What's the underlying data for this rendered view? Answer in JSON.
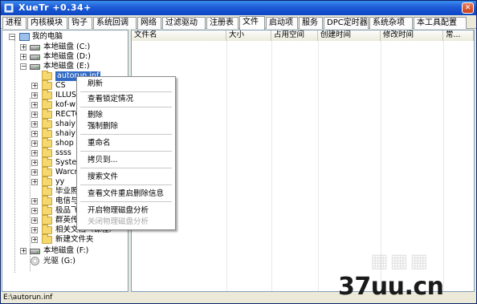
{
  "window": {
    "title": "XueTr +0.34+",
    "close_glyph": "✕"
  },
  "tabs": [
    "进程",
    "内核模块",
    "钩子",
    "系统回调",
    "网络",
    "过滤驱动",
    "注册表",
    "文件",
    "启动项",
    "服务",
    "DPC定时器",
    "系统杂项",
    "本工具配置"
  ],
  "active_tab": "文件",
  "tree": {
    "items": [
      {
        "label": "我的电脑",
        "icon": "computer-icon",
        "expander": "−"
      },
      {
        "label": "本地磁盘 (C:)",
        "icon": "drive-icon",
        "expander": "+"
      },
      {
        "label": "本地磁盘 (D:)",
        "icon": "drive-icon",
        "expander": "+"
      },
      {
        "label": "本地磁盘 (E:)",
        "icon": "drive-icon",
        "expander": "−"
      },
      {
        "label": "autorun.inf",
        "icon": "folder-icon",
        "expander": ""
      },
      {
        "label": "CS",
        "icon": "folder-icon",
        "expander": "+"
      },
      {
        "label": "ILLUS",
        "icon": "folder-icon",
        "expander": "+"
      },
      {
        "label": "kof-w",
        "icon": "folder-icon",
        "expander": "+"
      },
      {
        "label": "RECTC",
        "icon": "folder-icon",
        "expander": "+"
      },
      {
        "label": "shaiy",
        "icon": "folder-icon",
        "expander": "+"
      },
      {
        "label": "shaiy",
        "icon": "folder-icon",
        "expander": "+"
      },
      {
        "label": "shop",
        "icon": "folder-icon",
        "expander": "+"
      },
      {
        "label": "ssss",
        "icon": "folder-icon",
        "expander": "+"
      },
      {
        "label": "Syster",
        "icon": "folder-icon",
        "expander": "+"
      },
      {
        "label": "Warcr",
        "icon": "folder-icon",
        "expander": "+"
      },
      {
        "label": "yy",
        "icon": "folder-icon",
        "expander": "+"
      },
      {
        "label": "毕业照",
        "icon": "folder-icon",
        "expander": ""
      },
      {
        "label": "电信与",
        "icon": "folder-icon",
        "expander": "+"
      },
      {
        "label": "极品飞",
        "icon": "folder-icon",
        "expander": "+"
      },
      {
        "label": "群英传",
        "icon": "folder-icon",
        "expander": "+"
      },
      {
        "label": "相关文档（课程）",
        "icon": "folder-icon",
        "expander": "+"
      },
      {
        "label": "新建文件夹",
        "icon": "folder-icon",
        "expander": "+"
      },
      {
        "label": "本地磁盘 (F:)",
        "icon": "drive-icon",
        "expander": "+"
      },
      {
        "label": "光驱 (G:)",
        "icon": "cd-icon",
        "expander": ""
      }
    ]
  },
  "list": {
    "columns": [
      "文件名",
      "大小",
      "占用空间",
      "创建时间",
      "修改时间",
      "常..."
    ]
  },
  "context_menu": {
    "items": [
      "刷新",
      "查看锁定情况",
      "删除",
      "强制删除",
      "重命名",
      "拷贝到...",
      "搜索文件",
      "查看文件重启删除信息",
      "开启物理磁盘分析",
      "关闭物理磁盘分析"
    ]
  },
  "status": {
    "path": "E:\\autorun.inf"
  },
  "watermark": {
    "site": "37uu.cn"
  }
}
